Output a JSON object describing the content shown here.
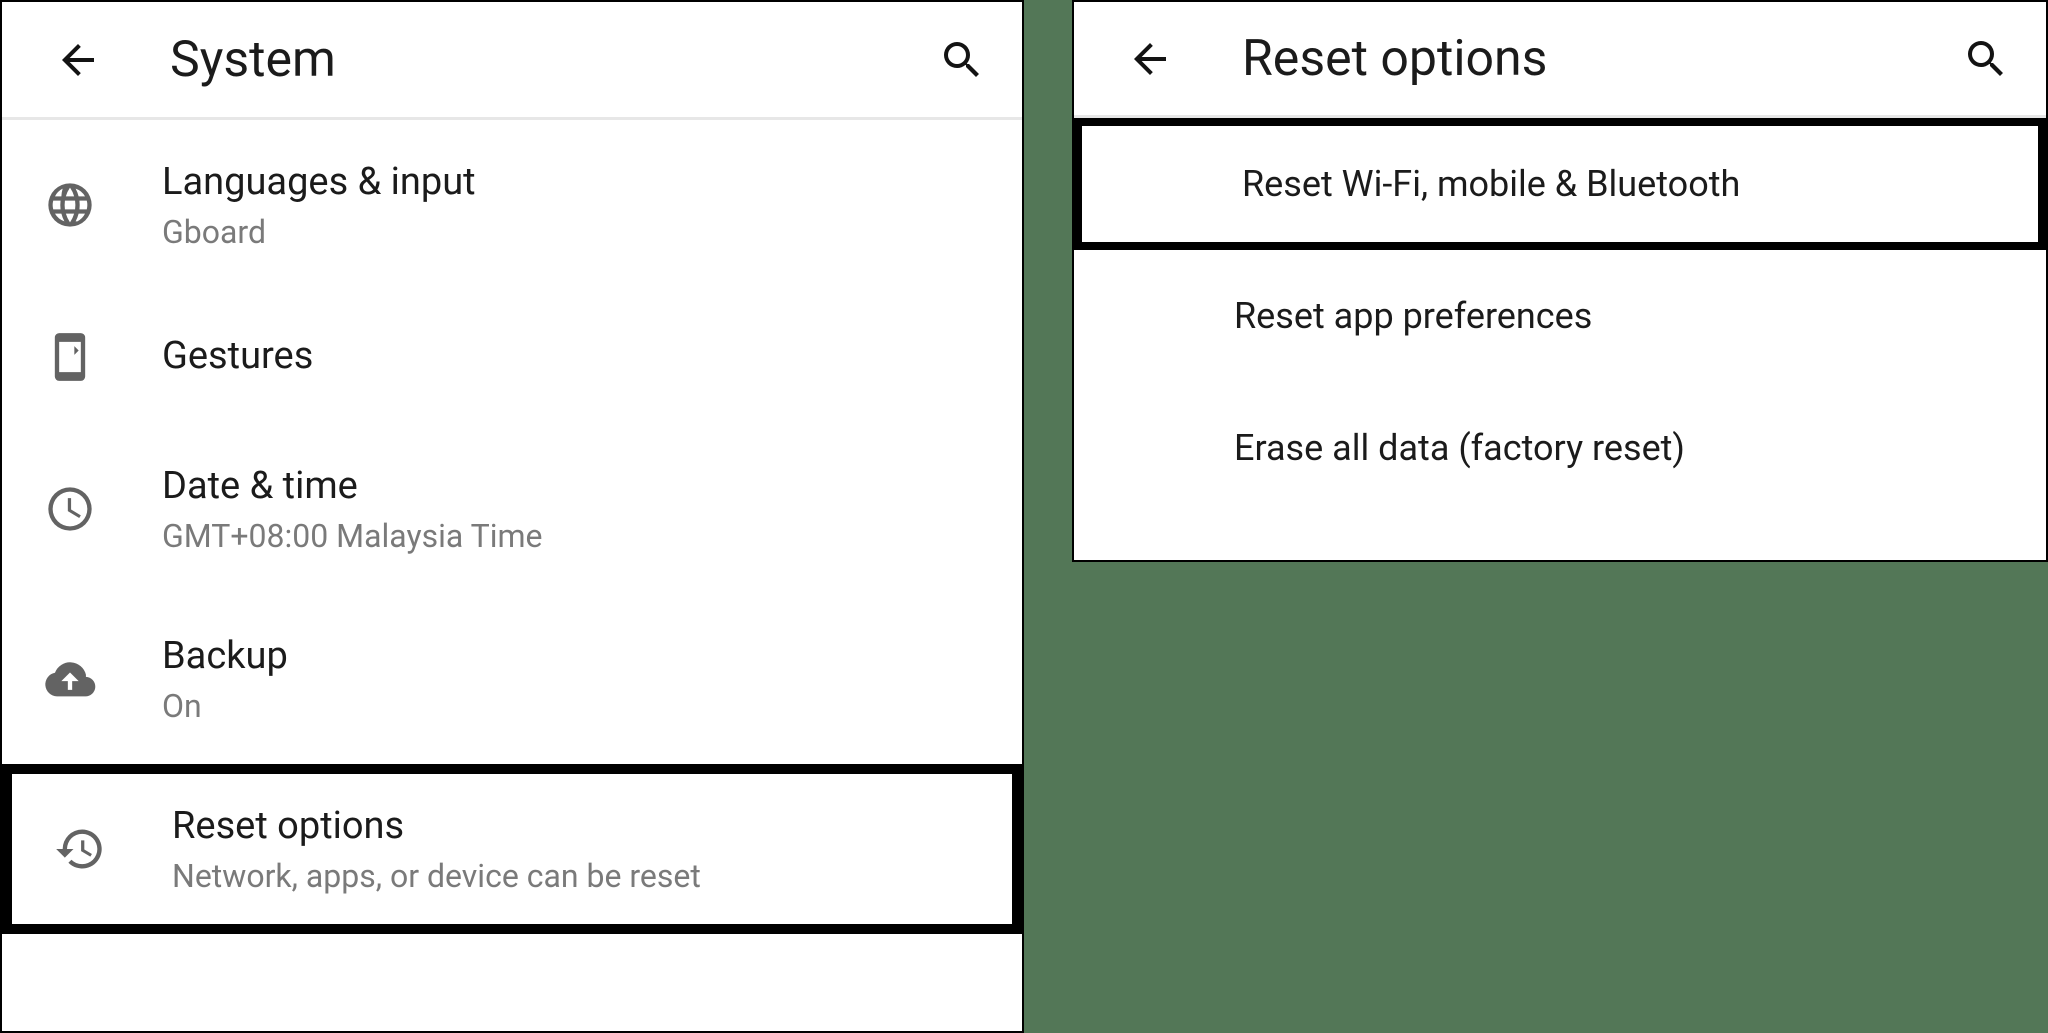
{
  "left": {
    "title": "System",
    "items": [
      {
        "label": "Languages & input",
        "sub": "Gboard",
        "icon": "globe"
      },
      {
        "label": "Gestures",
        "sub": "",
        "icon": "phone-gesture"
      },
      {
        "label": "Date & time",
        "sub": "GMT+08:00 Malaysia Time",
        "icon": "clock"
      },
      {
        "label": "Backup",
        "sub": "On",
        "icon": "cloud-up"
      },
      {
        "label": "Reset options",
        "sub": "Network, apps, or device can be reset",
        "icon": "history"
      }
    ]
  },
  "right": {
    "title": "Reset options",
    "items": [
      {
        "label": "Reset Wi-Fi, mobile & Bluetooth"
      },
      {
        "label": "Reset app preferences"
      },
      {
        "label": "Erase all data (factory reset)"
      }
    ]
  }
}
